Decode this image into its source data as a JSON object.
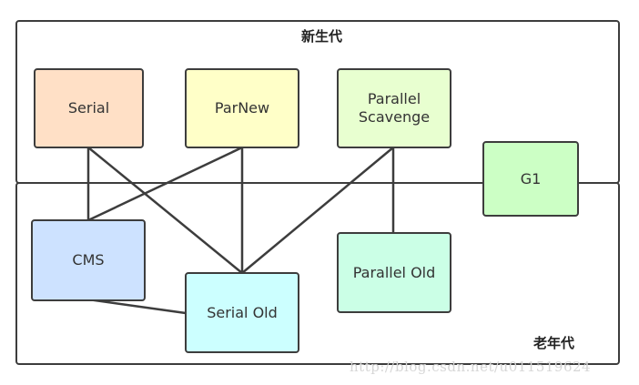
{
  "regions": {
    "young": {
      "label": "新生代"
    },
    "old": {
      "label": "老年代"
    }
  },
  "collectors": {
    "serial": {
      "label": "Serial",
      "color": "#ffe0c6"
    },
    "parnew": {
      "label": "ParNew",
      "color": "#ffffc8"
    },
    "parallel_scavenge": {
      "label": "Parallel\nScavenge",
      "color": "#e8ffd0"
    },
    "g1": {
      "label": "G1",
      "color": "#ccffc5"
    },
    "cms": {
      "label": "CMS",
      "color": "#cde2ff"
    },
    "serial_old": {
      "label": "Serial Old",
      "color": "#ccffff"
    },
    "parallel_old": {
      "label": "Parallel Old",
      "color": "#cbffe6"
    }
  },
  "links": [
    [
      "serial",
      "cms"
    ],
    [
      "serial",
      "serial_old"
    ],
    [
      "parnew",
      "cms"
    ],
    [
      "parnew",
      "serial_old"
    ],
    [
      "parallel_scavenge",
      "serial_old"
    ],
    [
      "parallel_scavenge",
      "parallel_old"
    ],
    [
      "cms",
      "serial_old"
    ]
  ],
  "watermark": "http://blog.csdn.net/u011519624"
}
